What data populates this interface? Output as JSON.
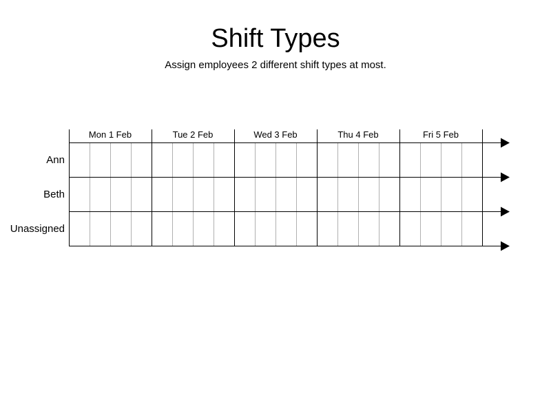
{
  "header": {
    "title": "Shift Types",
    "subtitle": "Assign employees 2 different shift types at most."
  },
  "schedule": {
    "days": [
      "Mon 1 Feb",
      "Tue 2 Feb",
      "Wed 3 Feb",
      "Thu 4 Feb",
      "Fri 5 Feb"
    ],
    "rows": [
      "Ann",
      "Beth",
      "Unassigned"
    ],
    "subdivisions_per_day": 4,
    "colors": {
      "major_line": "#000000",
      "minor_line": "#b0b0b0"
    }
  }
}
